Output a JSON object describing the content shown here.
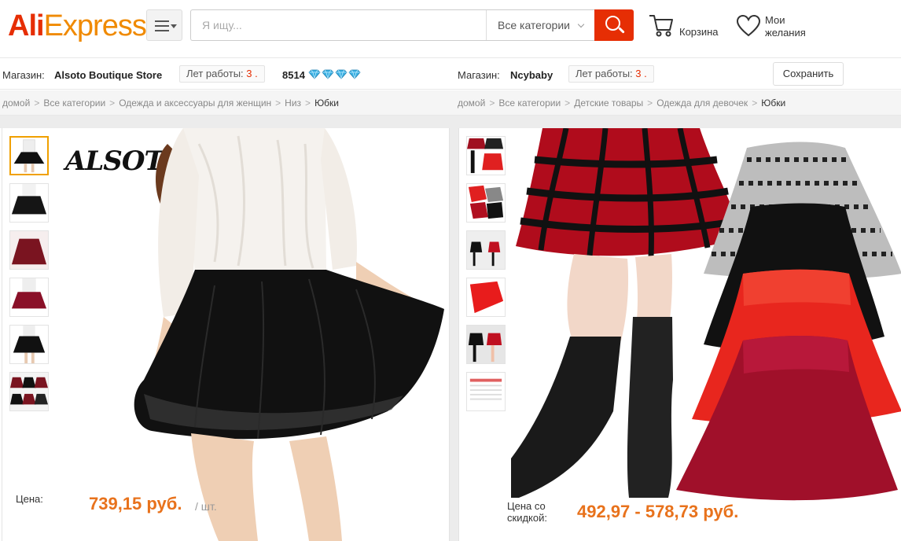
{
  "header": {
    "logo_ali": "Ali",
    "logo_express": "Express",
    "logo_tm": "™",
    "search_placeholder": "Я ищу...",
    "category_select": "Все категории",
    "cart_label": "Корзина",
    "wishlist_line1": "Мои",
    "wishlist_line2": "желания"
  },
  "left_store": {
    "label": "Магазин:",
    "name": "Alsoto Boutique Store",
    "years_label": "Лет работы:",
    "years_value": "3 .",
    "rating": "8514",
    "diamonds": 4
  },
  "right_store": {
    "label": "Магазин:",
    "name": "Ncybaby",
    "years_label": "Лет работы:",
    "years_value": "3 .",
    "save_label": "Сохранить"
  },
  "left_breadcrumb": [
    "домой",
    "Все категории",
    "Одежда и аксессуары для женщин",
    "Низ",
    "Юбки"
  ],
  "right_breadcrumb": [
    "домой",
    "Все категории",
    "Детские товары",
    "Одежда для девочек",
    "Юбки"
  ],
  "left_product": {
    "brand": "ALSOTO",
    "brand_mark": "®",
    "price_label": "Цена:",
    "price": "739,15 руб.",
    "unit": "/ шт."
  },
  "right_product": {
    "price_label_line1": "Цена со",
    "price_label_line2": "скидкой:",
    "price": "492,97 - 578,73 руб."
  },
  "colors": {
    "brand_red": "#e62e04",
    "brand_orange": "#f08a00",
    "price_orange": "#e8721c",
    "diamond_blue": "#3ab0e2"
  }
}
